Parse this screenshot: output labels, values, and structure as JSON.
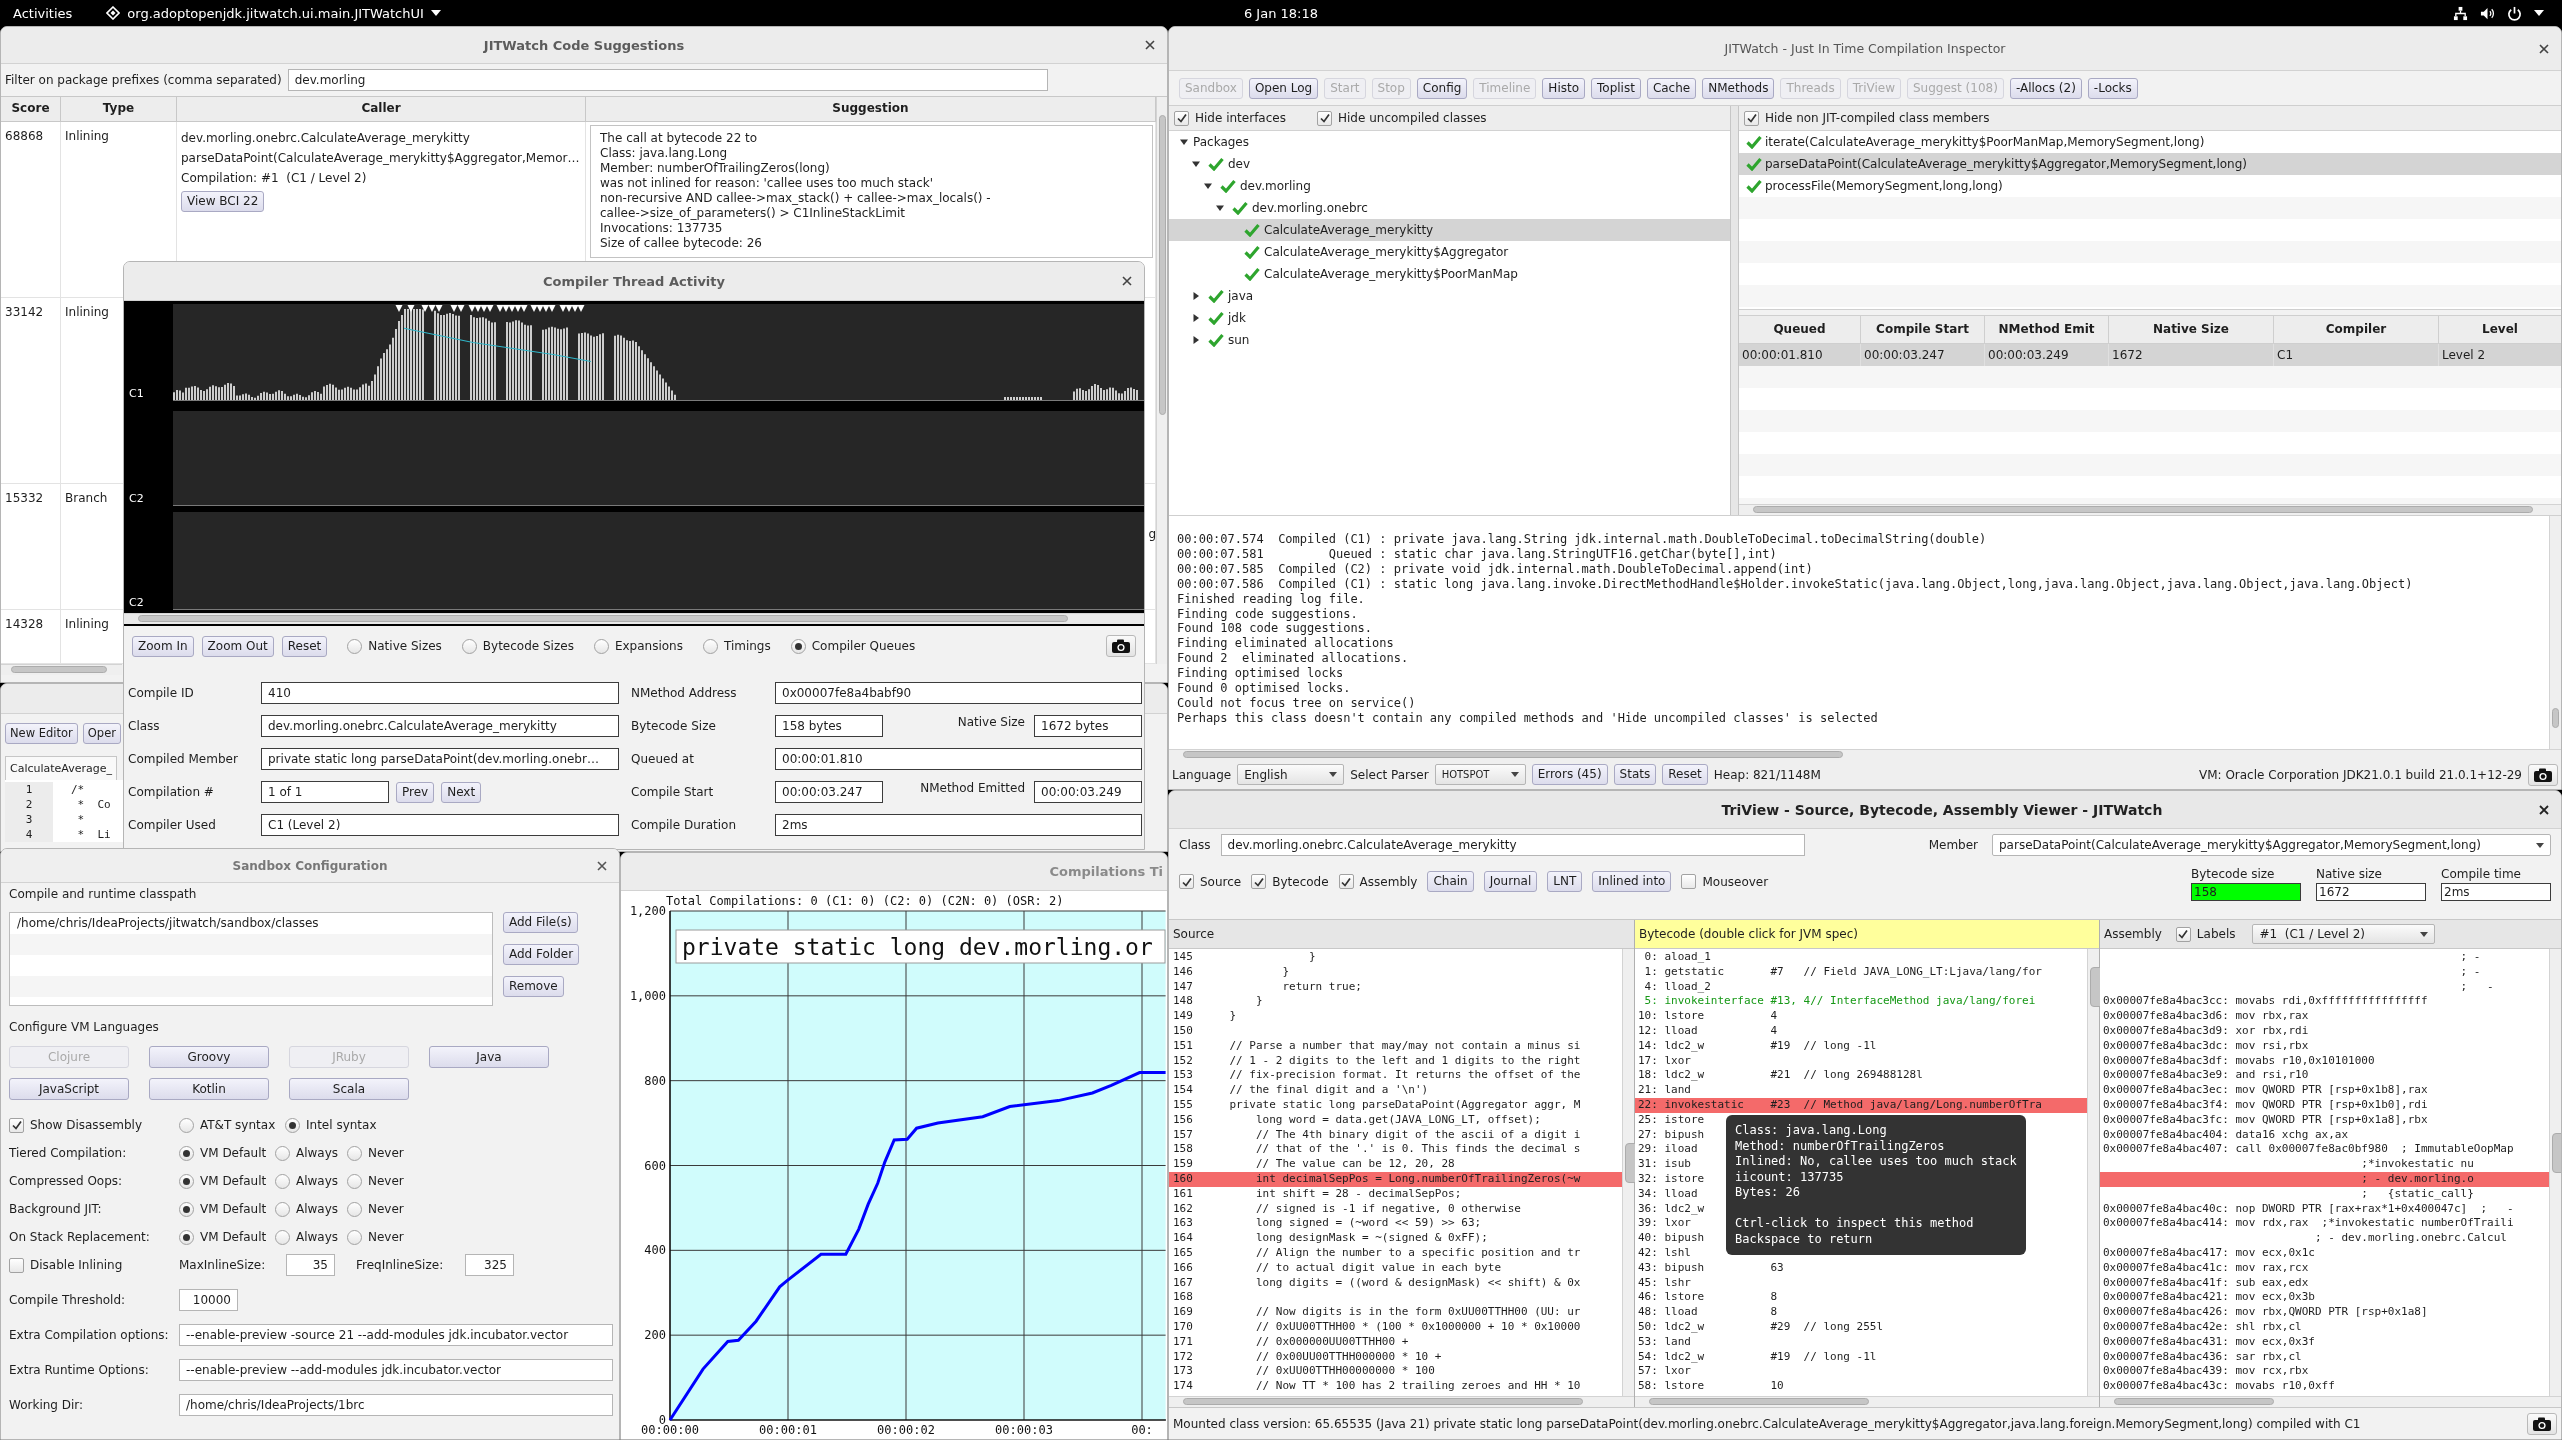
{
  "top_bar": {
    "activities": "Activities",
    "app_menu": "org.adoptopenjdk.jitwatch.ui.main.JITWatchUI",
    "clock": "6 Jan 18:18"
  },
  "suggestions_window": {
    "title": "JITWatch Code Suggestions",
    "filter": {
      "label": "Filter on package prefixes (comma separated)",
      "value": "dev.morling"
    },
    "columns": [
      "Score",
      "Type",
      "Caller",
      "Suggestion"
    ],
    "rows": [
      {
        "score": "68868",
        "type": "Inlining",
        "caller": [
          "dev.morling.onebrc.CalculateAverage_merykitty",
          "parseDataPoint(CalculateAverage_merykitty$Aggregator,Memor…",
          "Compilation: #1  (C1 / Level 2)"
        ],
        "button": "View BCI 22",
        "suggestion": [
          "The call at bytecode 22 to",
          "Class: java.lang.Long",
          "Member: numberOfTrailingZeros(long)",
          "was not inlined for reason: 'callee uses too much stack'",
          "non-recursive AND callee->max_stack() + callee->max_locals() -",
          "callee->size_of_parameters() > C1InlineStackLimit",
          "Invocations: 137735",
          "Size of callee bytecode: 26"
        ]
      },
      {
        "score": "33142",
        "type": "Inlining"
      },
      {
        "score": "15332",
        "type": "Branch",
        "suggestion": [
          "g"
        ]
      },
      {
        "score": "14328",
        "type": "Inlining"
      }
    ]
  },
  "sandbox_window": {
    "buttons": [
      "New Editor",
      "Oper"
    ],
    "tab": "CalculateAverage_",
    "lines": [
      {
        "number": "1",
        "code": "/*"
      },
      {
        "number": "2",
        "code": " *  Co"
      },
      {
        "number": "3",
        "code": " *"
      },
      {
        "number": "4",
        "code": " *  Li"
      }
    ]
  },
  "compiler_thread_window": {
    "title": "Compiler Thread Activity",
    "lanes": [
      "C1",
      "C2",
      "C2"
    ],
    "buttons": [
      "Zoom In",
      "Zoom Out",
      "Reset"
    ],
    "views": [
      {
        "label": "Native Sizes",
        "selected": false
      },
      {
        "label": "Bytecode Sizes",
        "selected": false
      },
      {
        "label": "Expansions",
        "selected": false
      },
      {
        "label": "Timings",
        "selected": false
      },
      {
        "label": "Compiler Queues",
        "selected": true
      }
    ],
    "details": [
      {
        "label": "Compile ID",
        "value": "410",
        "right_label": "NMethod Address",
        "right_value": "0x00007fe8a4babf90"
      },
      {
        "label": "Class",
        "value": "dev.morling.onebrc.CalculateAverage_merykitty",
        "right_label": "Bytecode Size",
        "right_value": "158 bytes",
        "extra_label": "Native Size",
        "extra_value": "1672 bytes"
      },
      {
        "label": "Compiled Member",
        "value": "private static long parseDataPoint(dev.morling.onebr…",
        "right_label": "Queued at",
        "right_value": "00:00:01.810"
      },
      {
        "label": "Compilation #",
        "value": "1 of 1",
        "buttons": [
          "Prev",
          "Next"
        ],
        "right_label": "Compile Start",
        "right_value": "00:00:03.247",
        "extra_label": "NMethod Emitted",
        "extra_value": "00:00:03.249"
      },
      {
        "label": "Compiler Used",
        "value": "C1 (Level 2)",
        "right_label": "Compile Duration",
        "right_value": "2ms"
      }
    ]
  },
  "sandbox_config": {
    "title": "Sandbox Configuration",
    "classpath_label": "Compile and runtime classpath",
    "classpath": [
      "/home/chris/IdeaProjects/jitwatch/sandbox/classes"
    ],
    "classpath_buttons": [
      "Add File(s)",
      "Add Folder",
      "Remove"
    ],
    "languages_label": "Configure VM Languages",
    "languages": [
      {
        "label": "Clojure",
        "disabled": true
      },
      {
        "label": "Groovy",
        "disabled": false
      },
      {
        "label": "JRuby",
        "disabled": true
      },
      {
        "label": "Java",
        "disabled": false
      },
      {
        "label": "JavaScript",
        "disabled": false
      },
      {
        "label": "Kotlin",
        "disabled": false
      },
      {
        "label": "Scala",
        "disabled": false
      }
    ],
    "disassembly": {
      "label": "Show Disassembly",
      "checked": true,
      "options": [
        {
          "label": "AT&T syntax",
          "selected": false
        },
        {
          "label": "Intel syntax",
          "selected": true
        }
      ]
    },
    "vm_options": [
      {
        "label": "Tiered Compilation:",
        "options": [
          {
            "label": "VM Default",
            "selected": true
          },
          {
            "label": "Always",
            "selected": false
          },
          {
            "label": "Never",
            "selected": false
          }
        ]
      },
      {
        "label": "Compressed Oops:",
        "options": [
          {
            "label": "VM Default",
            "selected": true
          },
          {
            "label": "Always",
            "selected": false
          },
          {
            "label": "Never",
            "selected": false
          }
        ]
      },
      {
        "label": "Background JIT:",
        "options": [
          {
            "label": "VM Default",
            "selected": true
          },
          {
            "label": "Always",
            "selected": false
          },
          {
            "label": "Never",
            "selected": false
          }
        ]
      },
      {
        "label": "On Stack Replacement:",
        "options": [
          {
            "label": "VM Default",
            "selected": true
          },
          {
            "label": "Always",
            "selected": false
          },
          {
            "label": "Never",
            "selected": false
          }
        ]
      }
    ],
    "inlining": {
      "label": "Disable Inlining",
      "checked": false,
      "max_label": "MaxInlineSize:",
      "max_value": "35",
      "freq_label": "FreqInlineSize:",
      "freq_value": "325"
    },
    "fields": [
      {
        "kind": "number",
        "label": "Compile Threshold:",
        "value": "10000"
      },
      {
        "kind": "text",
        "label": "Extra Compilation options:",
        "value": "--enable-preview -source 21 --add-modules jdk.incubator.vector"
      },
      {
        "kind": "text",
        "label": "Extra Runtime Options:",
        "value": "--enable-preview --add-modules jdk.incubator.vector"
      },
      {
        "kind": "text",
        "label": "Working Dir:",
        "value": "/home/chris/IdeaProjects/1brc"
      }
    ]
  },
  "timeline_window": {
    "title": "Compilations Ti",
    "partial_x_label": "00:",
    "chart_data": {
      "type": "line",
      "title": "Total Compilations: 0 (C1: 0) (C2: 0) (C2N: 0) (OSR: 2)",
      "x": [
        0,
        0.28,
        0.49,
        0.58,
        0.73,
        0.93,
        0.99,
        1.28,
        1.49,
        1.6,
        1.68,
        1.76,
        1.82,
        1.9,
        2.01,
        2.09,
        2.27,
        2.65,
        2.88,
        3.29,
        3.58,
        3.74,
        3.98,
        4.2
      ],
      "series": [
        {
          "color": "#0000ff",
          "values": [
            0,
            120,
            185,
            188,
            233,
            314,
            328,
            391,
            391,
            450,
            509,
            558,
            608,
            660,
            662,
            688,
            700,
            715,
            739,
            753,
            771,
            789,
            819,
            819
          ]
        }
      ],
      "xlim": [
        0,
        4.2
      ],
      "ylim": [
        0,
        1200
      ],
      "xticks": [
        {
          "value": 0,
          "label": "00:00:00"
        },
        {
          "value": 1,
          "label": "00:00:01"
        },
        {
          "value": 2,
          "label": "00:00:02"
        },
        {
          "value": 3,
          "label": "00:00:03"
        }
      ],
      "yticks": [
        {
          "value": 0,
          "label": "0"
        },
        {
          "value": 200,
          "label": "200"
        },
        {
          "value": 400,
          "label": "400"
        },
        {
          "value": 600,
          "label": "600"
        },
        {
          "value": 800,
          "label": "800"
        },
        {
          "value": 1000,
          "label": "1,000"
        },
        {
          "value": 1200,
          "label": "1,200"
        }
      ],
      "grid": true,
      "annotations": [
        {
          "text": "private static long dev.morling.or"
        }
      ]
    }
  },
  "main_window": {
    "title": "JITWatch - Just In Time Compilation Inspector",
    "toolbar": [
      {
        "label": "Sandbox",
        "disabled": true
      },
      {
        "label": "Open Log",
        "disabled": false
      },
      {
        "label": "Start",
        "disabled": true
      },
      {
        "label": "Stop",
        "disabled": true
      },
      {
        "label": "Config",
        "disabled": false
      },
      {
        "label": "Timeline",
        "disabled": true
      },
      {
        "label": "Histo",
        "disabled": false
      },
      {
        "label": "Toplist",
        "disabled": false
      },
      {
        "label": "Cache",
        "disabled": false
      },
      {
        "label": "NMethods",
        "disabled": false
      },
      {
        "label": "Threads",
        "disabled": true
      },
      {
        "label": "TriView",
        "disabled": true
      },
      {
        "label": "Suggest (108)",
        "disabled": true
      },
      {
        "label": "-Allocs (2)",
        "disabled": false
      },
      {
        "label": "-Locks",
        "disabled": false
      }
    ],
    "tree_options": [
      {
        "label": "Hide interfaces",
        "checked": true
      },
      {
        "label": "Hide uncompiled classes",
        "checked": true
      }
    ],
    "tree": [
      {
        "label": "Packages",
        "compiled": false,
        "expanded": true,
        "selected": false,
        "children": [
          {
            "label": "dev",
            "compiled": true,
            "expanded": true,
            "selected": false,
            "children": [
              {
                "label": "dev.morling",
                "compiled": true,
                "expanded": true,
                "selected": false,
                "children": [
                  {
                    "label": "dev.morling.onebrc",
                    "compiled": true,
                    "expanded": true,
                    "selected": false,
                    "children": [
                      {
                        "label": "CalculateAverage_merykitty",
                        "compiled": true,
                        "selected": true
                      },
                      {
                        "label": "CalculateAverage_merykitty$Aggregator",
                        "compiled": true,
                        "selected": false
                      },
                      {
                        "label": "CalculateAverage_merykitty$PoorManMap",
                        "compiled": true,
                        "selected": false
                      }
                    ]
                  }
                ]
              }
            ]
          },
          {
            "label": "java",
            "compiled": true,
            "expanded": false,
            "selected": false
          },
          {
            "label": "jdk",
            "compiled": true,
            "expanded": false,
            "selected": false
          },
          {
            "label": "sun",
            "compiled": true,
            "expanded": false,
            "selected": false
          }
        ]
      }
    ],
    "members_option": {
      "label": "Hide non JIT-compiled class members",
      "checked": true
    },
    "members": [
      {
        "label": "iterate(CalculateAverage_merykitty$PoorManMap,MemorySegment,long)",
        "compiled": true,
        "selected": false
      },
      {
        "label": "parseDataPoint(CalculateAverage_merykitty$Aggregator,MemorySegment,long)",
        "compiled": true,
        "selected": true
      },
      {
        "label": "processFile(MemorySegment,long,long)",
        "compiled": true,
        "selected": false
      }
    ],
    "compilations": {
      "columns": [
        "Queued",
        "Compile Start",
        "NMethod Emit",
        "Native Size",
        "Compiler",
        "Level"
      ],
      "rows": [
        {
          "cells": [
            "00:00:01.810",
            "00:00:03.247",
            "00:00:03.249",
            "1672",
            "C1",
            "Level 2"
          ],
          "selected": true
        }
      ]
    },
    "log": [
      "00:00:07.574  Compiled (C1) : private java.lang.String jdk.internal.math.DoubleToDecimal.toDecimalString(double)",
      "00:00:07.581         Queued : static char java.lang.StringUTF16.getChar(byte[],int)",
      "00:00:07.585  Compiled (C2) : private void jdk.internal.math.DoubleToDecimal.append(int)",
      "00:00:07.586  Compiled (C1) : static long java.lang.invoke.DirectMethodHandle$Holder.invokeStatic(java.lang.Object,long,java.lang.Object,java.lang.Object,java.lang.Object)",
      "Finished reading log file.",
      "Finding code suggestions.",
      "Found 108 code suggestions.",
      "Finding eliminated allocations",
      "Found 2  eliminated allocations.",
      "Finding optimised locks",
      "Found 0 optimised locks.",
      "Could not focus tree on service()",
      "Perhaps this class doesn't contain any compiled methods and 'Hide uncompiled classes' is selected"
    ],
    "status": {
      "language_label": "Language",
      "language": "English",
      "parser_label": "Select Parser",
      "parser": "HOTSPOT",
      "buttons": [
        "Errors (45)",
        "Stats",
        "Reset"
      ],
      "heap": "Heap: 821/1148M",
      "vm": "VM: Oracle Corporation JDK21.0.1 build 21.0.1+12-29"
    }
  },
  "triview": {
    "title": "TriView - Source, Bytecode, Assembly Viewer - JITWatch",
    "class_label": "Class",
    "class_value": "dev.morling.onebrc.CalculateAverage_merykitty",
    "member_label": "Member",
    "member_value": "parseDataPoint(CalculateAverage_merykitty$Aggregator,MemorySegment,long)",
    "toggles": [
      {
        "kind": "checkbox",
        "label": "Source",
        "checked": true
      },
      {
        "kind": "checkbox",
        "label": "Bytecode",
        "checked": true
      },
      {
        "kind": "checkbox",
        "label": "Assembly",
        "checked": true
      },
      {
        "kind": "button",
        "label": "Chain"
      },
      {
        "kind": "button",
        "label": "Journal"
      },
      {
        "kind": "button",
        "label": "LNT"
      },
      {
        "kind": "button",
        "label": "Inlined into"
      },
      {
        "kind": "checkbox",
        "label": "Mouseover",
        "checked": false
      }
    ],
    "stats": [
      {
        "label": "Bytecode size",
        "value": "158",
        "highlighted": true
      },
      {
        "label": "Native size",
        "value": "1672",
        "highlighted": false
      },
      {
        "label": "Compile time",
        "value": "2ms",
        "highlighted": false
      }
    ],
    "source": {
      "title": "Source",
      "lines": [
        {
          "number": "145",
          "code": "                }",
          "highlighted": false
        },
        {
          "number": "146",
          "code": "            }",
          "highlighted": false
        },
        {
          "number": "147",
          "code": "            return true;",
          "highlighted": false
        },
        {
          "number": "148",
          "code": "        }",
          "highlighted": false
        },
        {
          "number": "149",
          "code": "    }",
          "highlighted": false
        },
        {
          "number": "150",
          "highlighted": false
        },
        {
          "number": "151",
          "code": "    // Parse a number that may/may not contain a minus si",
          "highlighted": false
        },
        {
          "number": "152",
          "code": "    // 1 - 2 digits to the left and 1 digits to the right",
          "highlighted": false
        },
        {
          "number": "153",
          "code": "    // fix-precision format. It returns the offset of the",
          "highlighted": false
        },
        {
          "number": "154",
          "code": "    // the final digit and a '\\n')",
          "highlighted": false
        },
        {
          "number": "155",
          "code": "    private static long parseDataPoint(Aggregator aggr, M",
          "highlighted": false
        },
        {
          "number": "156",
          "code": "        long word = data.get(JAVA_LONG_LT, offset);",
          "highlighted": false
        },
        {
          "number": "157",
          "code": "        // The 4th binary digit of the ascii of a digit i",
          "highlighted": false
        },
        {
          "number": "158",
          "code": "        // that of the '.' is 0. This finds the decimal s",
          "highlighted": false
        },
        {
          "number": "159",
          "code": "        // The value can be 12, 20, 28",
          "highlighted": false
        },
        {
          "number": "160",
          "code": "        int decimalSepPos = Long.numberOfTrailingZeros(~w",
          "highlighted": true
        },
        {
          "number": "161",
          "code": "        int shift = 28 - decimalSepPos;",
          "highlighted": false
        },
        {
          "number": "162",
          "code": "        // signed is -1 if negative, 0 otherwise",
          "highlighted": false
        },
        {
          "number": "163",
          "code": "        long signed = (~word << 59) >> 63;",
          "highlighted": false
        },
        {
          "number": "164",
          "code": "        long designMask = ~(signed & 0xFF);",
          "highlighted": false
        },
        {
          "number": "165",
          "code": "        // Align the number to a specific position and tr",
          "highlighted": false
        },
        {
          "number": "166",
          "code": "        // to actual digit value in each byte",
          "highlighted": false
        },
        {
          "number": "167",
          "code": "        long digits = ((word & designMask) << shift) & 0x",
          "highlighted": false
        },
        {
          "number": "168",
          "highlighted": false
        },
        {
          "number": "169",
          "code": "        // Now digits is in the form 0xUU00TTHH00 (UU: ur",
          "highlighted": false
        },
        {
          "number": "170",
          "code": "        // 0xUU00TTHH00 * (100 * 0x1000000 + 10 * 0x10000",
          "highlighted": false
        },
        {
          "number": "171",
          "code": "        // 0x000000UU00TTHH00 +",
          "highlighted": false
        },
        {
          "number": "172",
          "code": "        // 0x00UU00TTHH000000 * 10 +",
          "highlighted": false
        },
        {
          "number": "173",
          "code": "        // 0xUU00TTHH00000000 * 100",
          "highlighted": false
        },
        {
          "number": "174",
          "code": "        // Now TT * 100 has 2 trailing zeroes and HH * 10",
          "highlighted": false
        }
      ]
    },
    "bytecode": {
      "title": "Bytecode (double click for JVM spec)",
      "lines": [
        {
          "text": " 0: aload_1",
          "kind": "plain"
        },
        {
          "text": " 1: getstatic       #7   // Field JAVA_LONG_LT:Ljava/lang/for",
          "kind": "plain"
        },
        {
          "text": " 4: lload_2",
          "kind": "plain"
        },
        {
          "text": " 5: invokeinterface #13, 4// InterfaceMethod java/lang/forei",
          "kind": "inlined"
        },
        {
          "text": "10: lstore          4",
          "kind": "plain"
        },
        {
          "text": "12: lload           4",
          "kind": "plain"
        },
        {
          "text": "14: ldc2_w          #19  // long -1l",
          "kind": "plain"
        },
        {
          "text": "17: lxor",
          "kind": "plain"
        },
        {
          "text": "18: ldc2_w          #21  // long 269488128l",
          "kind": "plain"
        },
        {
          "text": "21: land",
          "kind": "plain"
        },
        {
          "text": "22: invokestatic    #23  // Method java/lang/Long.numberOfTra",
          "kind": "not_inlined"
        },
        {
          "text": "25: istore",
          "kind": "plain"
        },
        {
          "text": "27: bipush",
          "kind": "plain"
        },
        {
          "text": "29: iload",
          "kind": "plain"
        },
        {
          "text": "31: isub",
          "kind": "plain"
        },
        {
          "text": "32: istore",
          "kind": "plain"
        },
        {
          "text": "34: lload",
          "kind": "plain"
        },
        {
          "text": "36: ldc2_w",
          "kind": "plain"
        },
        {
          "text": "39: lxor",
          "kind": "plain"
        },
        {
          "text": "40: bipush",
          "kind": "plain"
        },
        {
          "text": "42: lshl",
          "kind": "plain"
        },
        {
          "text": "43: bipush          63",
          "kind": "plain"
        },
        {
          "text": "45: lshr",
          "kind": "plain"
        },
        {
          "text": "46: lstore          8",
          "kind": "plain"
        },
        {
          "text": "48: lload           8",
          "kind": "plain"
        },
        {
          "text": "50: ldc2_w          #29  // long 255l",
          "kind": "plain"
        },
        {
          "text": "53: land",
          "kind": "plain"
        },
        {
          "text": "54: ldc2_w          #19  // long -1l",
          "kind": "plain"
        },
        {
          "text": "57: lxor",
          "kind": "plain"
        },
        {
          "text": "58: lstore          10",
          "kind": "plain"
        }
      ]
    },
    "assembly": {
      "title": "Assembly",
      "labels": {
        "label": "Labels",
        "checked": true
      },
      "compilation": "#1  (C1 / Level 2)",
      "lines": [
        {
          "text": "                                                      ; -",
          "highlighted": false
        },
        {
          "text": "                                                      ; -",
          "highlighted": false
        },
        {
          "text": "                                                      ;   -",
          "highlighted": false
        },
        {
          "text": "0x00007fe8a4bac3cc: movabs rdi,0xffffffffffffffff",
          "highlighted": false
        },
        {
          "text": "0x00007fe8a4bac3d6: mov rbx,rax",
          "highlighted": false
        },
        {
          "text": "0x00007fe8a4bac3d9: xor rbx,rdi",
          "highlighted": false
        },
        {
          "text": "0x00007fe8a4bac3dc: mov rsi,rbx",
          "highlighted": false
        },
        {
          "text": "0x00007fe8a4bac3df: movabs r10,0x10101000",
          "highlighted": false
        },
        {
          "text": "0x00007fe8a4bac3e9: and rsi,r10",
          "highlighted": false
        },
        {
          "text": "0x00007fe8a4bac3ec: mov QWORD PTR [rsp+0x1b8],rax",
          "highlighted": false
        },
        {
          "text": "0x00007fe8a4bac3f4: mov QWORD PTR [rsp+0x1b0],rdi",
          "highlighted": false
        },
        {
          "text": "0x00007fe8a4bac3fc: mov QWORD PTR [rsp+0x1a8],rbx",
          "highlighted": false
        },
        {
          "text": "0x00007fe8a4bac404: data16 xchg ax,ax",
          "highlighted": false
        },
        {
          "text": "0x00007fe8a4bac407: call 0x00007fe8ac0bf980  ; ImmutableOopMap",
          "highlighted": false
        },
        {
          "text": "                                       ;*invokestatic nu",
          "highlighted": false
        },
        {
          "text": "                                       ; - dev.morling.o",
          "highlighted": true
        },
        {
          "text": "                                       ;   {static_call}",
          "highlighted": false
        },
        {
          "text": "0x00007fe8a4bac40c: nop DWORD PTR [rax+rax*1+0x400047c]  ;   -",
          "highlighted": false
        },
        {
          "text": "0x00007fe8a4bac414: mov rdx,rax  ;*invokestatic numberOfTraili",
          "highlighted": false
        },
        {
          "text": "                                ; - dev.morling.onebrc.Calcul",
          "highlighted": false
        },
        {
          "text": "0x00007fe8a4bac417: mov ecx,0x1c",
          "highlighted": false
        },
        {
          "text": "0x00007fe8a4bac41c: mov rax,rcx",
          "highlighted": false
        },
        {
          "text": "0x00007fe8a4bac41f: sub eax,edx",
          "highlighted": false
        },
        {
          "text": "0x00007fe8a4bac421: mov ecx,0x3b",
          "highlighted": false
        },
        {
          "text": "0x00007fe8a4bac426: mov rbx,QWORD PTR [rsp+0x1a8]",
          "highlighted": false
        },
        {
          "text": "0x00007fe8a4bac42e: shl rbx,cl",
          "highlighted": false
        },
        {
          "text": "0x00007fe8a4bac431: mov ecx,0x3f",
          "highlighted": false
        },
        {
          "text": "0x00007fe8a4bac436: sar rbx,cl",
          "highlighted": false
        },
        {
          "text": "0x00007fe8a4bac439: mov rcx,rbx",
          "highlighted": false
        },
        {
          "text": "0x00007fe8a4bac43c: movabs r10,0xff",
          "highlighted": false
        }
      ]
    },
    "tooltip": {
      "info": [
        "Class: java.lang.Long",
        "Method: numberOfTrailingZeros",
        "Inlined: No, callee uses too much stack",
        "iicount: 137735",
        "Bytes: 26"
      ],
      "hints": [
        "Ctrl-click to inspect this method",
        "Backspace to return"
      ]
    },
    "status": "Mounted class version: 65.65535 (Java 21) private static long parseDataPoint(dev.morling.onebrc.CalculateAverage_merykitty$Aggregator,java.lang.foreign.MemorySegment,long) compiled with C1"
  }
}
